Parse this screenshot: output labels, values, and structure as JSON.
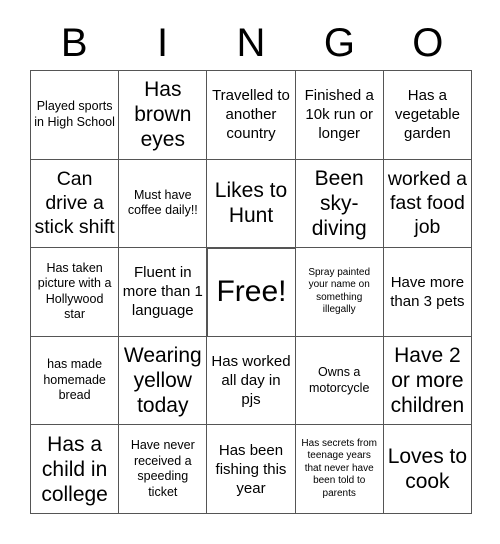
{
  "header": {
    "letters": [
      "B",
      "I",
      "N",
      "G",
      "O"
    ]
  },
  "grid": {
    "rows": 5,
    "columns": 5,
    "border_color": "#555555",
    "background_color": "#ffffff",
    "text_color": "#000000",
    "cells": [
      {
        "text": "Played sports in High School",
        "size": "fs-sm",
        "free": false
      },
      {
        "text": "Has brown eyes",
        "size": "fs-xl",
        "free": false
      },
      {
        "text": "Travelled to another country",
        "size": "fs-md",
        "free": false
      },
      {
        "text": "Finished a 10k run or longer",
        "size": "fs-md",
        "free": false
      },
      {
        "text": "Has a vegetable garden",
        "size": "fs-md",
        "free": false
      },
      {
        "text": "Can drive a stick shift",
        "size": "fs-lg",
        "free": false
      },
      {
        "text": "Must have coffee daily!!",
        "size": "fs-sm",
        "free": false
      },
      {
        "text": "Likes to Hunt",
        "size": "fs-xl",
        "free": false
      },
      {
        "text": "Been sky-diving",
        "size": "fs-xl",
        "free": false
      },
      {
        "text": "worked a fast food job",
        "size": "fs-lg",
        "free": false
      },
      {
        "text": "Has taken picture with a Hollywood star",
        "size": "fs-sm",
        "free": false
      },
      {
        "text": "Fluent in more than 1 language",
        "size": "fs-md",
        "free": false
      },
      {
        "text": "Free!",
        "size": "fs-free",
        "free": true
      },
      {
        "text": "Spray painted your name on something illegally",
        "size": "fs-xs",
        "free": false
      },
      {
        "text": "Have more than 3 pets",
        "size": "fs-md",
        "free": false
      },
      {
        "text": "has made homemade bread",
        "size": "fs-sm",
        "free": false
      },
      {
        "text": "Wearing yellow today",
        "size": "fs-xl",
        "free": false
      },
      {
        "text": "Has worked all day in pjs",
        "size": "fs-md",
        "free": false
      },
      {
        "text": "Owns a motorcycle",
        "size": "fs-sm",
        "free": false
      },
      {
        "text": "Have 2 or more children",
        "size": "fs-xl",
        "free": false
      },
      {
        "text": "Has a child in college",
        "size": "fs-xl",
        "free": false
      },
      {
        "text": "Have never received a speeding ticket",
        "size": "fs-sm",
        "free": false
      },
      {
        "text": "Has been fishing this year",
        "size": "fs-md",
        "free": false
      },
      {
        "text": "Has secrets from teenage years that never have been told to parents",
        "size": "fs-xs",
        "free": false
      },
      {
        "text": "Loves to cook",
        "size": "fs-xl",
        "free": false
      }
    ]
  }
}
